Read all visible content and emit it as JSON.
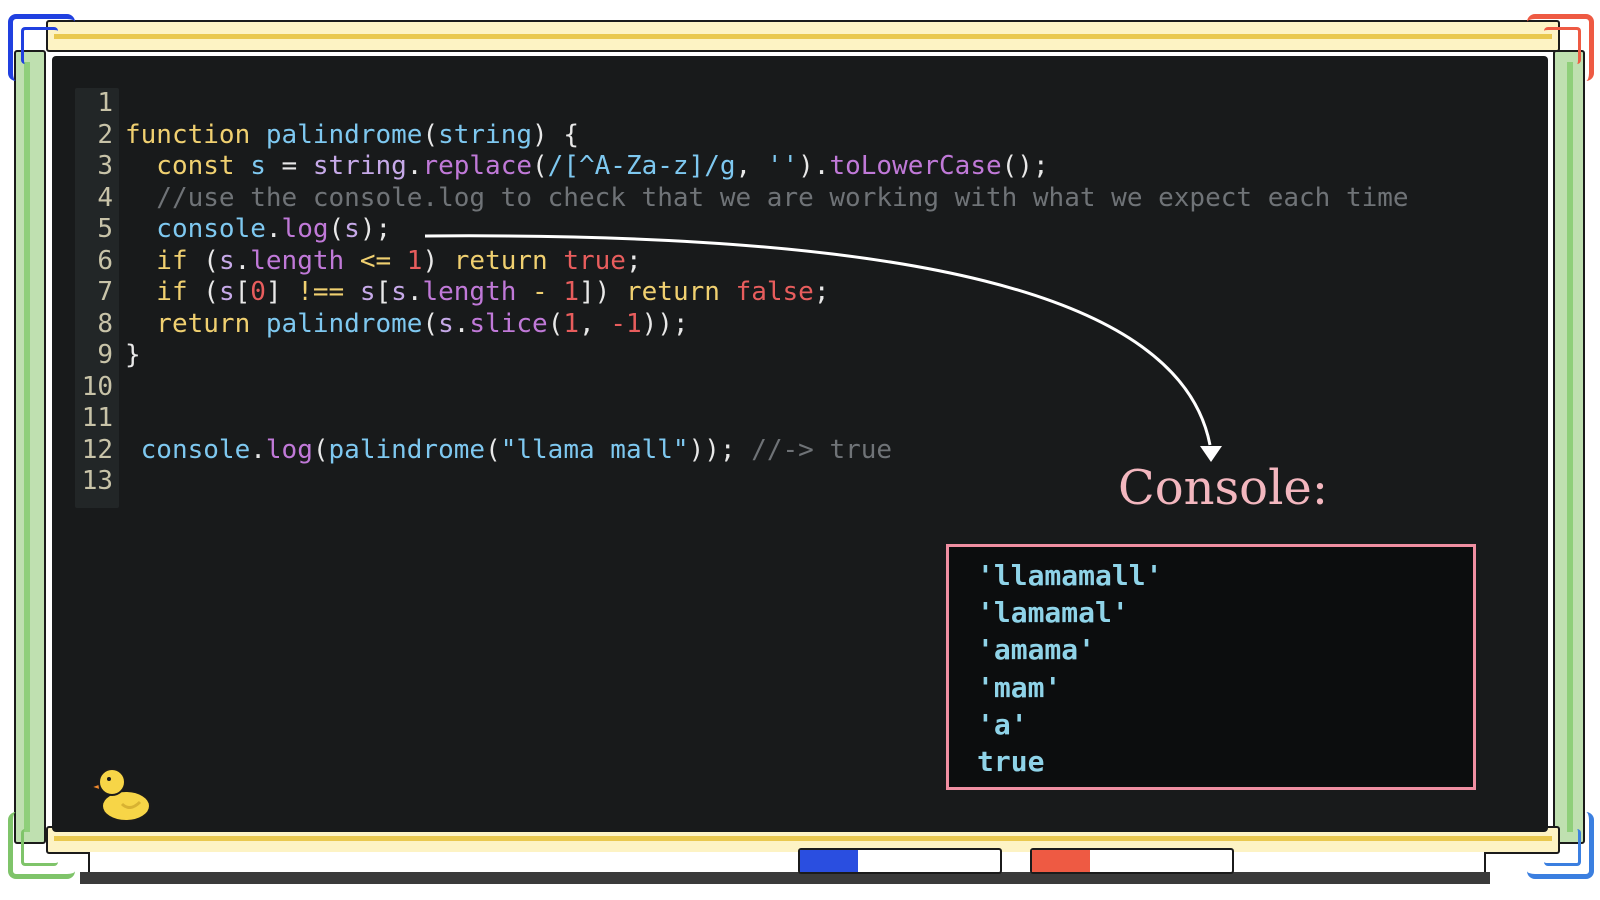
{
  "code": {
    "lines": [
      {
        "no": "1",
        "tokens": []
      },
      {
        "no": "2",
        "tokens": [
          {
            "t": "function ",
            "c": "kw"
          },
          {
            "t": "palindrome",
            "c": "fn"
          },
          {
            "t": "(",
            "c": "pun"
          },
          {
            "t": "string",
            "c": "fn"
          },
          {
            "t": ") {",
            "c": "pun"
          }
        ]
      },
      {
        "no": "3",
        "tokens": [
          {
            "t": "  const ",
            "c": "kw"
          },
          {
            "t": "s",
            "c": "fn"
          },
          {
            "t": " = ",
            "c": "pun"
          },
          {
            "t": "string",
            "c": "var"
          },
          {
            "t": ".",
            "c": "pun"
          },
          {
            "t": "replace",
            "c": "mt"
          },
          {
            "t": "(",
            "c": "pun"
          },
          {
            "t": "/[^A-Za-z]/g",
            "c": "str"
          },
          {
            "t": ", ",
            "c": "pun"
          },
          {
            "t": "''",
            "c": "str"
          },
          {
            "t": ").",
            "c": "pun"
          },
          {
            "t": "toLowerCase",
            "c": "mt"
          },
          {
            "t": "();",
            "c": "pun"
          }
        ]
      },
      {
        "no": "4",
        "tokens": [
          {
            "t": "  //use the console.log to check that we are working with what we expect each time",
            "c": "cmt"
          }
        ]
      },
      {
        "no": "5",
        "tokens": [
          {
            "t": "  console",
            "c": "fn"
          },
          {
            "t": ".",
            "c": "pun"
          },
          {
            "t": "log",
            "c": "mt"
          },
          {
            "t": "(",
            "c": "pun"
          },
          {
            "t": "s",
            "c": "var"
          },
          {
            "t": ");",
            "c": "pun"
          }
        ]
      },
      {
        "no": "6",
        "tokens": [
          {
            "t": "  if ",
            "c": "kw"
          },
          {
            "t": "(",
            "c": "pun"
          },
          {
            "t": "s",
            "c": "var"
          },
          {
            "t": ".",
            "c": "pun"
          },
          {
            "t": "length",
            "c": "mt"
          },
          {
            "t": " <= ",
            "c": "op"
          },
          {
            "t": "1",
            "c": "num"
          },
          {
            "t": ") ",
            "c": "pun"
          },
          {
            "t": "return ",
            "c": "kw"
          },
          {
            "t": "true",
            "c": "bool"
          },
          {
            "t": ";",
            "c": "pun"
          }
        ]
      },
      {
        "no": "7",
        "tokens": [
          {
            "t": "  if ",
            "c": "kw"
          },
          {
            "t": "(",
            "c": "pun"
          },
          {
            "t": "s",
            "c": "var"
          },
          {
            "t": "[",
            "c": "pun"
          },
          {
            "t": "0",
            "c": "num"
          },
          {
            "t": "] ",
            "c": "pun"
          },
          {
            "t": "!==",
            "c": "op"
          },
          {
            "t": " s",
            "c": "var"
          },
          {
            "t": "[",
            "c": "pun"
          },
          {
            "t": "s",
            "c": "var"
          },
          {
            "t": ".",
            "c": "pun"
          },
          {
            "t": "length",
            "c": "mt"
          },
          {
            "t": " - ",
            "c": "op"
          },
          {
            "t": "1",
            "c": "num"
          },
          {
            "t": "]) ",
            "c": "pun"
          },
          {
            "t": "return ",
            "c": "kw"
          },
          {
            "t": "false",
            "c": "bool"
          },
          {
            "t": ";",
            "c": "pun"
          }
        ]
      },
      {
        "no": "8",
        "tokens": [
          {
            "t": "  return ",
            "c": "kw"
          },
          {
            "t": "palindrome",
            "c": "fn"
          },
          {
            "t": "(",
            "c": "pun"
          },
          {
            "t": "s",
            "c": "var"
          },
          {
            "t": ".",
            "c": "pun"
          },
          {
            "t": "slice",
            "c": "mt"
          },
          {
            "t": "(",
            "c": "pun"
          },
          {
            "t": "1",
            "c": "num"
          },
          {
            "t": ", ",
            "c": "pun"
          },
          {
            "t": "-1",
            "c": "num"
          },
          {
            "t": "));",
            "c": "pun"
          }
        ]
      },
      {
        "no": "9",
        "tokens": [
          {
            "t": "}",
            "c": "pun"
          }
        ]
      },
      {
        "no": "10",
        "tokens": []
      },
      {
        "no": "11",
        "tokens": []
      },
      {
        "no": "12",
        "tokens": [
          {
            "t": " console",
            "c": "fn"
          },
          {
            "t": ".",
            "c": "pun"
          },
          {
            "t": "log",
            "c": "mt"
          },
          {
            "t": "(",
            "c": "pun"
          },
          {
            "t": "palindrome",
            "c": "fn"
          },
          {
            "t": "(",
            "c": "pun"
          },
          {
            "t": "\"llama mall\"",
            "c": "str"
          },
          {
            "t": ")); ",
            "c": "pun"
          },
          {
            "t": "//-> true",
            "c": "cmt"
          }
        ]
      },
      {
        "no": "13",
        "tokens": []
      }
    ]
  },
  "console": {
    "title": "Console:",
    "output": [
      "'llamamall'",
      "'lamamal'",
      "'amama'",
      "'mam'",
      "'a'",
      "true"
    ]
  },
  "colors": {
    "board": "#181a1b",
    "console_border": "#f08fa2",
    "console_title": "#f3b7bf",
    "console_text": "#8fd3e8",
    "marker_blue": "#2a4ee0",
    "marker_red": "#ee5a43"
  },
  "icons": [
    "rubber-duck-icon",
    "arrow-icon",
    "marker-icon"
  ]
}
